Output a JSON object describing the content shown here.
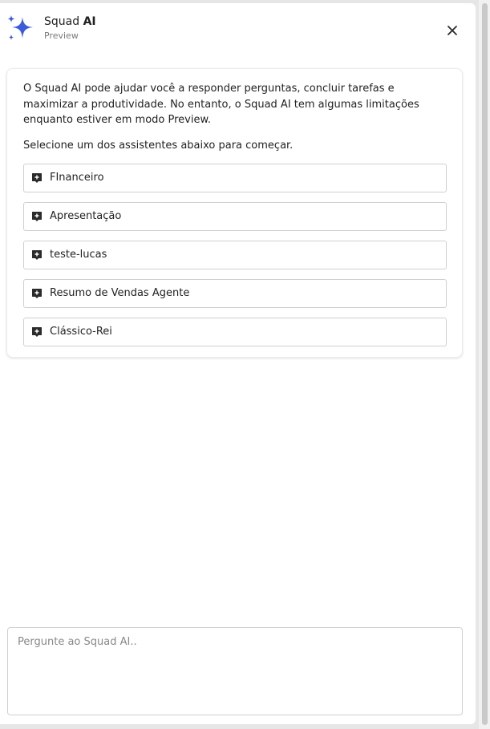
{
  "header": {
    "title_prefix": "Squad ",
    "title_emphasis": "AI",
    "subtitle": "Preview",
    "logo_icon": "sparkles-icon",
    "close_icon": "close-icon"
  },
  "intro": {
    "text": "O Squad AI pode ajudar você a responder perguntas, concluir tarefas e maximizar a produtividade. No entanto, o Squad AI tem algumas limitações enquanto estiver em modo Preview.",
    "select_prompt": "Selecione um dos assistentes abaixo para começar."
  },
  "assistants": [
    {
      "label": "FInanceiro",
      "icon": "assistant-add-icon"
    },
    {
      "label": "Apresentação",
      "icon": "assistant-add-icon"
    },
    {
      "label": "teste-lucas",
      "icon": "assistant-add-icon"
    },
    {
      "label": "Resumo de Vendas Agente",
      "icon": "assistant-add-icon"
    },
    {
      "label": "Clássico-Rei",
      "icon": "assistant-add-icon"
    }
  ],
  "chat_input": {
    "placeholder": "Pergunte ao Squad AI..",
    "value": ""
  },
  "colors": {
    "accent": "#3b5bd9",
    "icon_dark": "#2b2b2b"
  }
}
